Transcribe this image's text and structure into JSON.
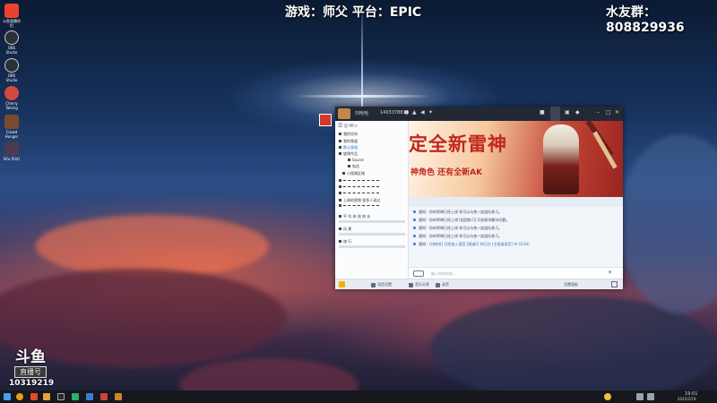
{
  "overlay": {
    "stream_info": "游戏：师父 平台：EPIC",
    "fan_group": "水友群：808829936"
  },
  "desktop_icons": [
    {
      "name": "斗鱼直播伴侣",
      "icon": "douyu-app-icon",
      "color": "#e8432c"
    },
    {
      "name": "OBS Studio",
      "icon": "obs-icon",
      "color": "#2b2f38"
    },
    {
      "name": "OBS Studio",
      "icon": "obs-icon",
      "color": "#2b2f38"
    },
    {
      "name": "Cherry Talking",
      "icon": "chat-app-icon",
      "color": "#d24a3c"
    },
    {
      "name": "Crowd Hunger",
      "icon": "game-icon",
      "color": "#7a4a2e"
    },
    {
      "name": "Sifu (Fist)",
      "icon": "game-icon",
      "color": "#4c3a55"
    }
  ],
  "chat_window": {
    "title_name": "刘哈哈",
    "room_id": "1403378810",
    "left_panel": {
      "rows": [
        "我的空间",
        "我的频道",
        "默认频道",
        "旋律作品",
        "Sound",
        "私信",
        "小视频区域",
        "上周的视频 很多人说过",
        "平 均 体 质 修 长",
        "风 景",
        "旅 行",
        "拍 照"
      ]
    },
    "banner": {
      "headline": "定全新雷神",
      "subline": "神角色  还有全新AK",
      "accent": "#c0281e"
    },
    "messages": [
      {
        "prefix": "通知：",
        "text": "你的师傅已经上线 你可以与他一起组队练习。"
      },
      {
        "prefix": "通知：",
        "text": "你的师傅已经上线 [组团练习] 开始帮你解决问题。"
      },
      {
        "prefix": "通知：",
        "text": "你的师傅已经上线 你可以与他一起组队练习。"
      },
      {
        "prefix": "通知：",
        "text": "你的师傅已经上线 你可以与他一起组队练习。"
      },
      {
        "prefix": "通知：",
        "text": "[刘哈哈] 已经加入语音 [频道2] 你已在 [主频道语音] 中 (1/34)"
      }
    ],
    "input_placeholder": "输入你的消息...",
    "bottom_bar": {
      "items": [
        "语音设置",
        "音乐分享",
        "录音",
        "设置"
      ],
      "right_items": [
        "设置面板"
      ]
    }
  },
  "douyu_logo": {
    "brand": "斗鱼",
    "tagline": "直播号",
    "room_number": "10319219"
  },
  "taskbar": {
    "time": "19:01",
    "date": "2022/2/19"
  }
}
